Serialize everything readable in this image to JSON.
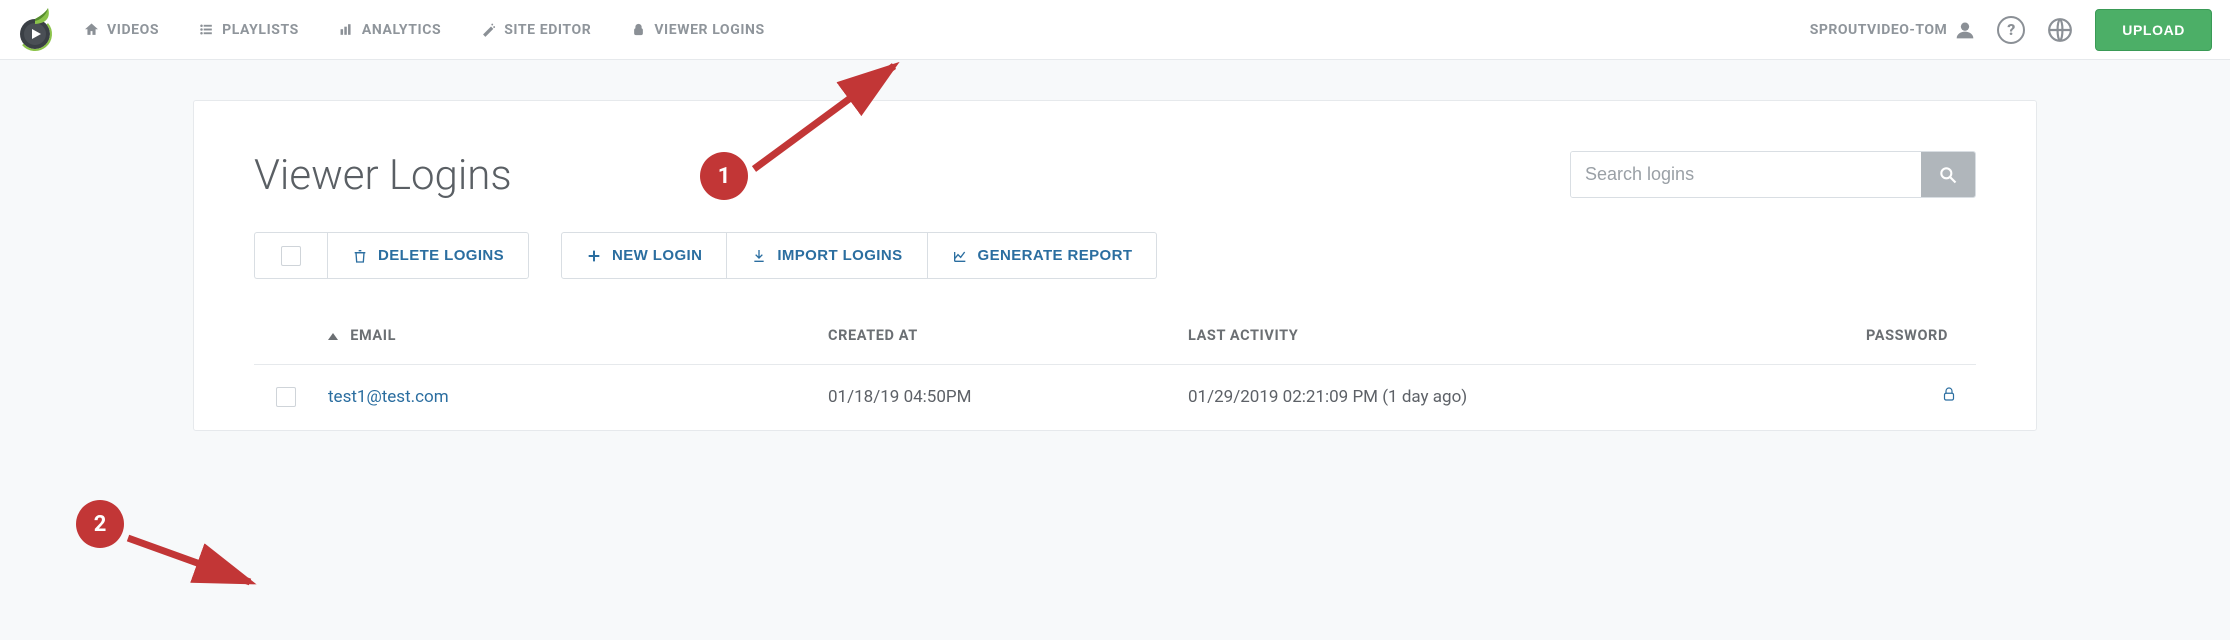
{
  "nav": {
    "videos": "VIDEOS",
    "playlists": "PLAYLISTS",
    "analytics": "ANALYTICS",
    "site_editor": "SITE EDITOR",
    "viewer_logins": "VIEWER LOGINS",
    "account_name": "SPROUTVIDEO-TOM",
    "upload": "UPLOAD"
  },
  "page": {
    "title": "Viewer Logins",
    "search_placeholder": "Search logins"
  },
  "actions": {
    "delete": "DELETE LOGINS",
    "new_login": "NEW LOGIN",
    "import": "IMPORT LOGINS",
    "report": "GENERATE REPORT"
  },
  "table": {
    "headers": {
      "email": "EMAIL",
      "created": "CREATED AT",
      "activity": "LAST ACTIVITY",
      "password": "PASSWORD"
    },
    "rows": [
      {
        "email": "test1@test.com",
        "created_at": "01/18/19 04:50PM",
        "last_activity": "01/29/2019 02:21:09 PM (1 day ago)"
      }
    ]
  },
  "annotations": {
    "b1": "1",
    "b2": "2"
  }
}
